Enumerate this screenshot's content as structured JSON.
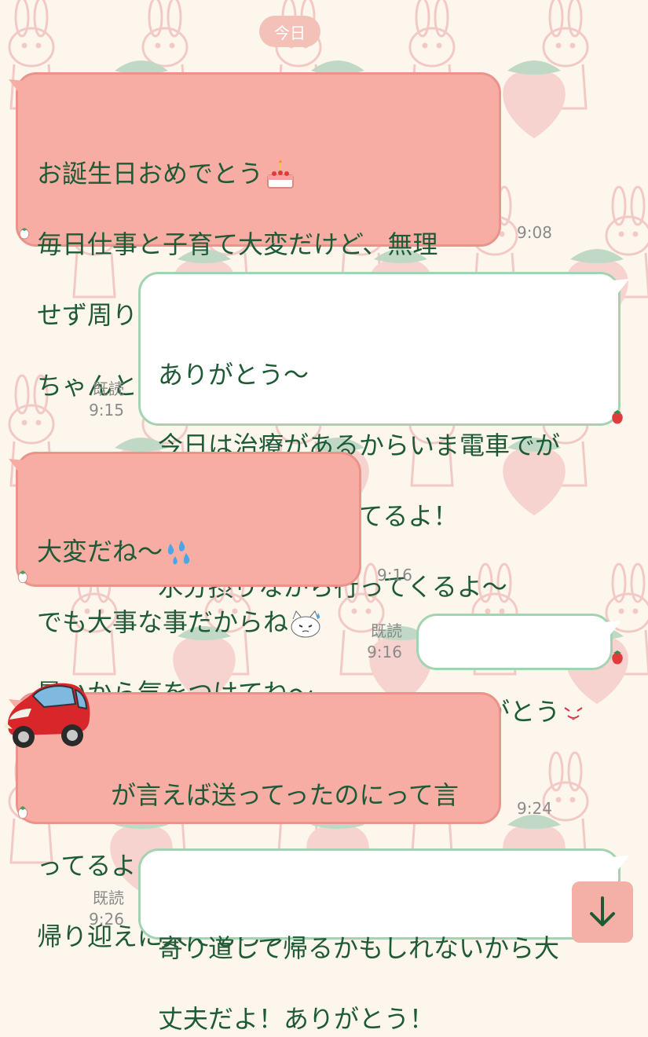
{
  "date_divider": "今日",
  "messages": [
    {
      "side": "left",
      "lines": [
        "お誕生日おめでとう",
        "毎日仕事と子育て大変だけど、無理",
        "せず周りに甘えながら頑張ろうね",
        "ちゃんと水分は摂るように"
      ],
      "time": "9:08"
    },
    {
      "side": "right",
      "lines": [
        "ありがとう〜",
        "今日は治療があるからいま電車でが",
        "んセンター向かってるよ！",
        "水分摂りながら行ってくるよ〜"
      ],
      "read": "既読",
      "time": "9:15"
    },
    {
      "side": "left",
      "lines": [
        "大変だね〜",
        "でも大事な事だからね",
        "暑いから気をつけてね〜"
      ],
      "time": "9:16"
    },
    {
      "side": "right",
      "lines": [
        "ありがとう"
      ],
      "read": "既読",
      "time": "9:16"
    },
    {
      "side": "left",
      "lines": [
        "が言えば送ってったのにって言",
        "ってるよ",
        "帰り迎えに来てもらう？"
      ],
      "time": "9:24"
    },
    {
      "side": "right",
      "lines": [
        "寄り道して帰るかもしれないから大",
        "丈夫だよ！ありがとう！"
      ],
      "read": "既読",
      "time": "9:26"
    }
  ],
  "icons": {
    "scroll_down": "arrow-down-icon",
    "strawberry": "strawberry-icon",
    "car": "red-car-sticker"
  },
  "colors": {
    "left_bubble": "#f8ada4",
    "right_bubble": "#ffffff",
    "text": "#1e5a35",
    "accent": "#f4b0a6"
  }
}
